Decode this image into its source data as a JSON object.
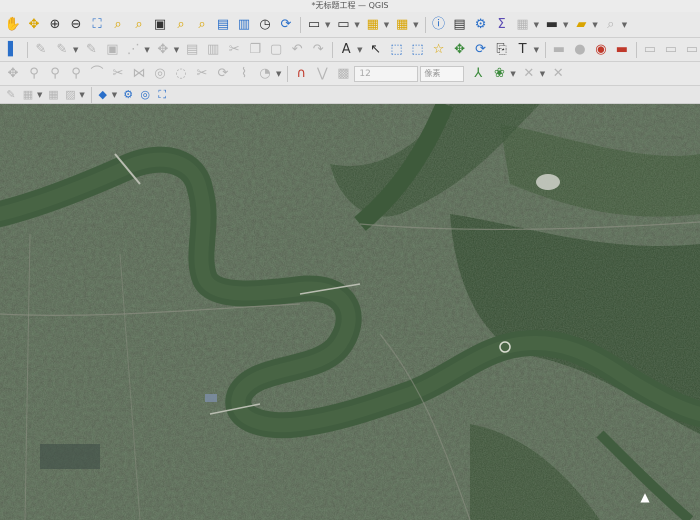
{
  "window": {
    "title": "*无标题工程 — QGIS"
  },
  "toolbar_snap": {
    "tolerance_value": "12",
    "unit_label": "像素"
  },
  "colors": {
    "toolbar_bg": "#e9e9e9",
    "river": "#3f5a3c",
    "land_urban": "#4f5a49",
    "forest": "#2f4a2c"
  },
  "icons": {
    "row1": [
      "pan-map-icon",
      "pan-to-selection-icon",
      "zoom-in-icon",
      "zoom-out-icon",
      "zoom-full-icon",
      "zoom-to-selection-icon",
      "zoom-to-layer-icon",
      "zoom-native-icon",
      "zoom-last-icon",
      "zoom-next-icon",
      "new-bookmark-icon",
      "show-bookmarks-icon",
      "temporal-controller-icon",
      "refresh-icon",
      "select-features-icon",
      "deselect-icon",
      "open-attribute-table-icon",
      "statistics-icon",
      "field-calculator-icon",
      "toolbox-icon",
      "sum-icon",
      "measure-icon",
      "annotation-icon",
      "map-tips-icon",
      "identify-icon"
    ],
    "row2": [
      "digitize-icon",
      "current-edits-icon",
      "toggle-editing-icon",
      "save-edits-icon",
      "add-feature-icon",
      "vertex-tool-icon",
      "delete-selected-icon",
      "cut-icon",
      "copy-icon",
      "paste-icon",
      "undo-icon",
      "redo-icon",
      "label-toolbar-icon",
      "layer-labeling-icon",
      "pin-labels-icon",
      "show-labels-icon",
      "move-label-icon",
      "rotate-label-icon",
      "change-label-icon",
      "text-annotation-icon",
      "python-icon",
      "plugin-icon"
    ],
    "row3": [
      "advanced-digitize-icon",
      "snapping-icon",
      "tracing-icon",
      "offset-icon",
      "reshape-icon",
      "split-icon",
      "merge-icon",
      "fill-ring-icon",
      "delete-ring-icon",
      "delete-part-icon",
      "rotate-icon",
      "simplify-icon",
      "magnet-icon"
    ],
    "row4": [
      "layer-style-icon",
      "layer-order-icon",
      "python-console-icon",
      "settings-gear-icon",
      "search-icon",
      "fullscreen-icon"
    ]
  }
}
